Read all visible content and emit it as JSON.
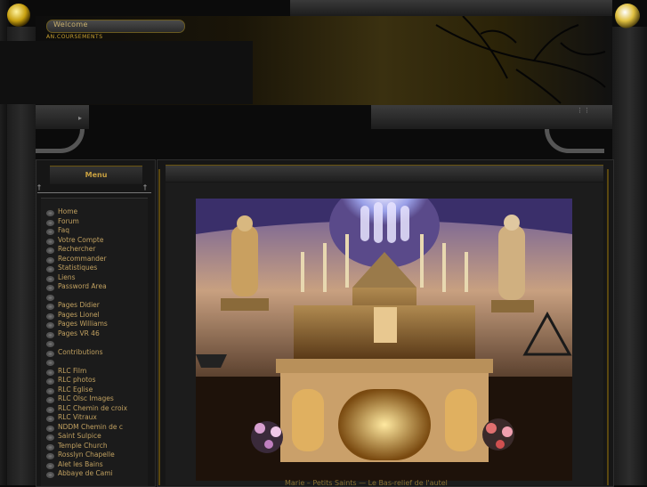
{
  "header": {
    "welcome_label": "Welcome",
    "ribbon_text": "AN.COURSEMENTS",
    "top_right_text": ""
  },
  "menu": {
    "title": "Menu",
    "items": [
      {
        "label": "Home"
      },
      {
        "label": "Forum"
      },
      {
        "label": "Faq"
      },
      {
        "label": "Votre Compte"
      },
      {
        "label": "Rechercher"
      },
      {
        "label": "Recommander"
      },
      {
        "label": "Statistiques"
      },
      {
        "label": "Liens"
      },
      {
        "label": "Password Area"
      },
      {
        "label": ""
      },
      {
        "label": "Pages Didier"
      },
      {
        "label": "Pages Lionel"
      },
      {
        "label": "Pages Williams"
      },
      {
        "label": "Pages VR 46"
      },
      {
        "label": ""
      },
      {
        "label": "Contributions"
      },
      {
        "label": ""
      },
      {
        "label": "RLC Film"
      },
      {
        "label": "RLC photos"
      },
      {
        "label": "RLC Eglise"
      },
      {
        "label": "RLC Olsc Images"
      },
      {
        "label": "RLC Chemin de croix"
      },
      {
        "label": "RLC Vitraux"
      },
      {
        "label": "NDDM Chemin de c"
      },
      {
        "label": "Saint Sulpice"
      },
      {
        "label": "Temple Church"
      },
      {
        "label": "Rosslyn Chapelle"
      },
      {
        "label": "Alet les Bains"
      },
      {
        "label": "Abbaye de Cami"
      }
    ]
  },
  "content": {
    "caption": "Marie – Petits Saints — Le Bas-relief de l'autel"
  },
  "colors": {
    "accent_gold": "#c8a040",
    "background": "#0b0b0b",
    "panel": "#161616"
  }
}
